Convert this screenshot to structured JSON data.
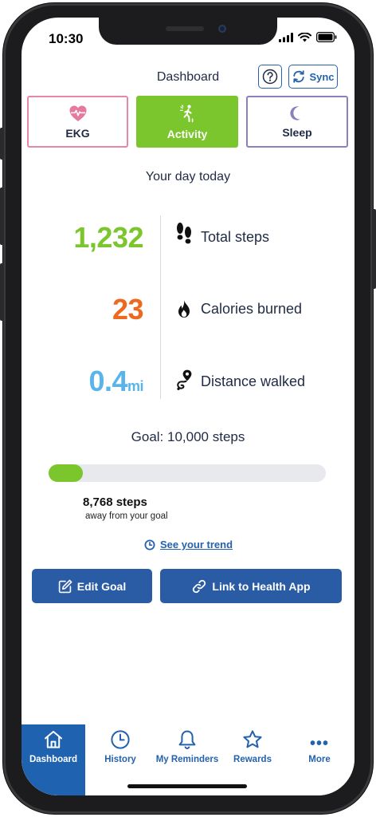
{
  "status_bar": {
    "time": "10:30"
  },
  "header": {
    "title": "Dashboard",
    "help_icon": "question-icon",
    "sync_label": "Sync"
  },
  "tabs": [
    {
      "label": "EKG",
      "icon": "heart-pulse-icon",
      "color": "#e688a4"
    },
    {
      "label": "Activity",
      "icon": "person-walking-icon",
      "color": "#7bc62d",
      "selected": true
    },
    {
      "label": "Sleep",
      "icon": "moon-icon",
      "color": "#8c7fbf"
    }
  ],
  "summary": {
    "title": "Your day today",
    "stats": [
      {
        "value": "1,232",
        "label": "Total steps",
        "icon": "footprints-icon",
        "color": "#7bc62d"
      },
      {
        "value": "23",
        "label": "Calories burned",
        "icon": "flame-icon",
        "color": "#ec6a20"
      },
      {
        "value": "0.4",
        "unit": "mi",
        "label": "Distance walked",
        "icon": "route-pin-icon",
        "color": "#5ab4ec"
      }
    ]
  },
  "goal": {
    "title": "Goal: 10,000 steps",
    "progress_fraction": 0.1232,
    "remaining_count": "8,768 steps",
    "remaining_label": "away from your goal",
    "trend_link": "See your trend"
  },
  "actions": {
    "edit_goal": "Edit Goal",
    "link_health": "Link to Health App"
  },
  "bottom_nav": [
    {
      "label": "Dashboard",
      "icon": "home-icon",
      "active": true
    },
    {
      "label": "History",
      "icon": "clock-icon"
    },
    {
      "label": "My Reminders",
      "icon": "bell-icon"
    },
    {
      "label": "Rewards",
      "icon": "star-icon"
    },
    {
      "label": "More",
      "icon": "ellipsis-icon"
    }
  ],
  "colors": {
    "accent_blue": "#2462ad",
    "nav_active": "#1f63b0",
    "button_blue": "#2a5ba5",
    "activity_green": "#7bc62d"
  }
}
